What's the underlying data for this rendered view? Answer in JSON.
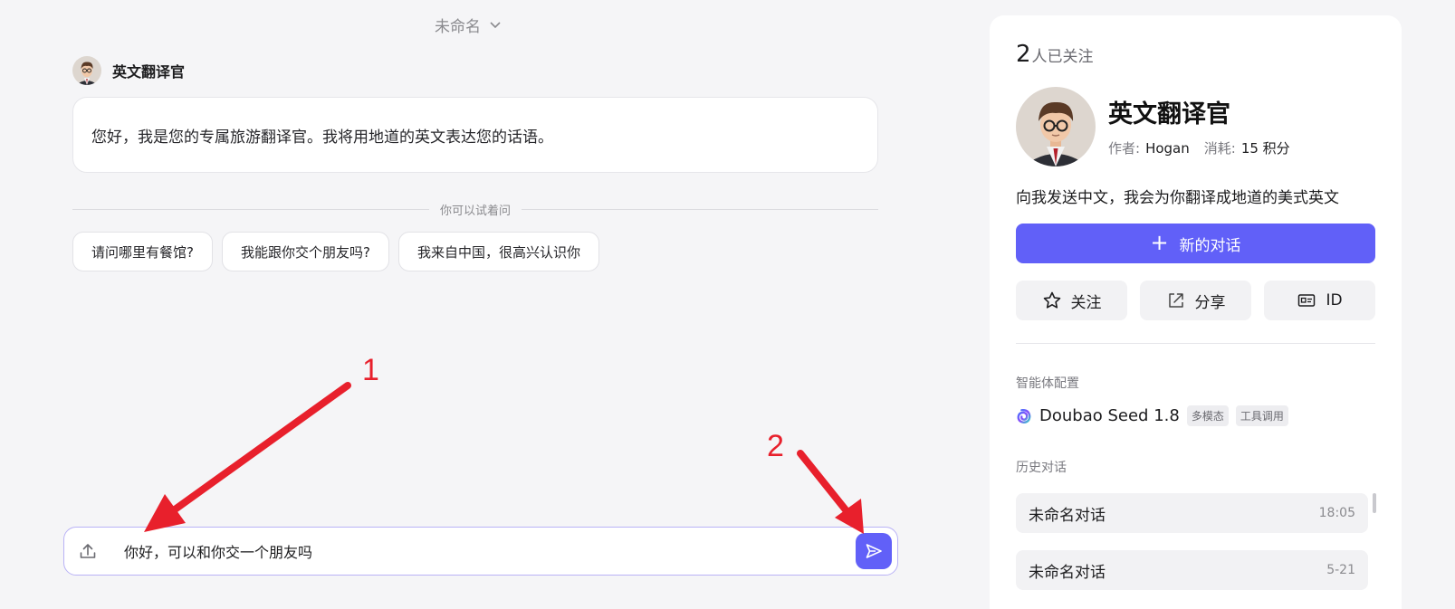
{
  "conversation": {
    "title": "未命名"
  },
  "bot": {
    "name": "英文翻译官"
  },
  "greeting": "您好，我是您的专属旅游翻译官。我将用地道的英文表达您的话语。",
  "suggestions": {
    "label": "你可以试着问",
    "items": [
      "请问哪里有餐馆?",
      "我能跟你交个朋友吗?",
      "我来自中国，很高兴认识你"
    ]
  },
  "composer": {
    "value": "你好，可以和你交一个朋友吗"
  },
  "annotations": {
    "one": "1",
    "two": "2",
    "color": "#e8202c"
  },
  "panel": {
    "followers_count": "2",
    "followers_label": "人已关注",
    "name": "英文翻译官",
    "author_label": "作者:",
    "author": "Hogan",
    "cost_label": "消耗:",
    "cost": "15 积分",
    "description": "向我发送中文，我会为你翻译成地道的美式英文",
    "new_chat": "新的对话",
    "follow": "关注",
    "share": "分享",
    "id": "ID",
    "config_label": "智能体配置",
    "model": "Doubao Seed 1.8",
    "tags": [
      "多模态",
      "工具调用"
    ],
    "history_label": "历史对话",
    "history": [
      {
        "title": "未命名对话",
        "time": "18:05"
      },
      {
        "title": "未命名对话",
        "time": "5-21"
      }
    ]
  },
  "colors": {
    "accent": "#6160f8",
    "annotation": "#e8202c"
  }
}
